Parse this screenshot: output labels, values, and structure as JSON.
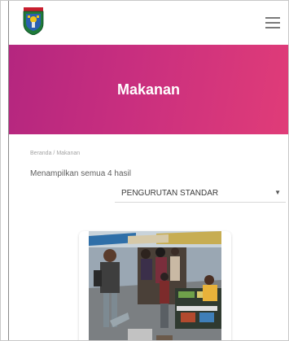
{
  "header": {
    "logo_icon": "regional-emblem-icon",
    "menu_icon": "hamburger-menu-icon"
  },
  "hero": {
    "title": "Makanan",
    "gradient_start": "#b4267f",
    "gradient_end": "#e03c78"
  },
  "breadcrumb": {
    "home_label": "Beranda",
    "separator": "/",
    "current_label": "Makanan"
  },
  "results_text": "Menampilkan semua 4 hasil",
  "sort": {
    "selected": "PENGURUTAN STANDAR",
    "caret_icon": "caret-down-icon"
  },
  "products": [
    {
      "image": "street-food-market-photo"
    }
  ]
}
